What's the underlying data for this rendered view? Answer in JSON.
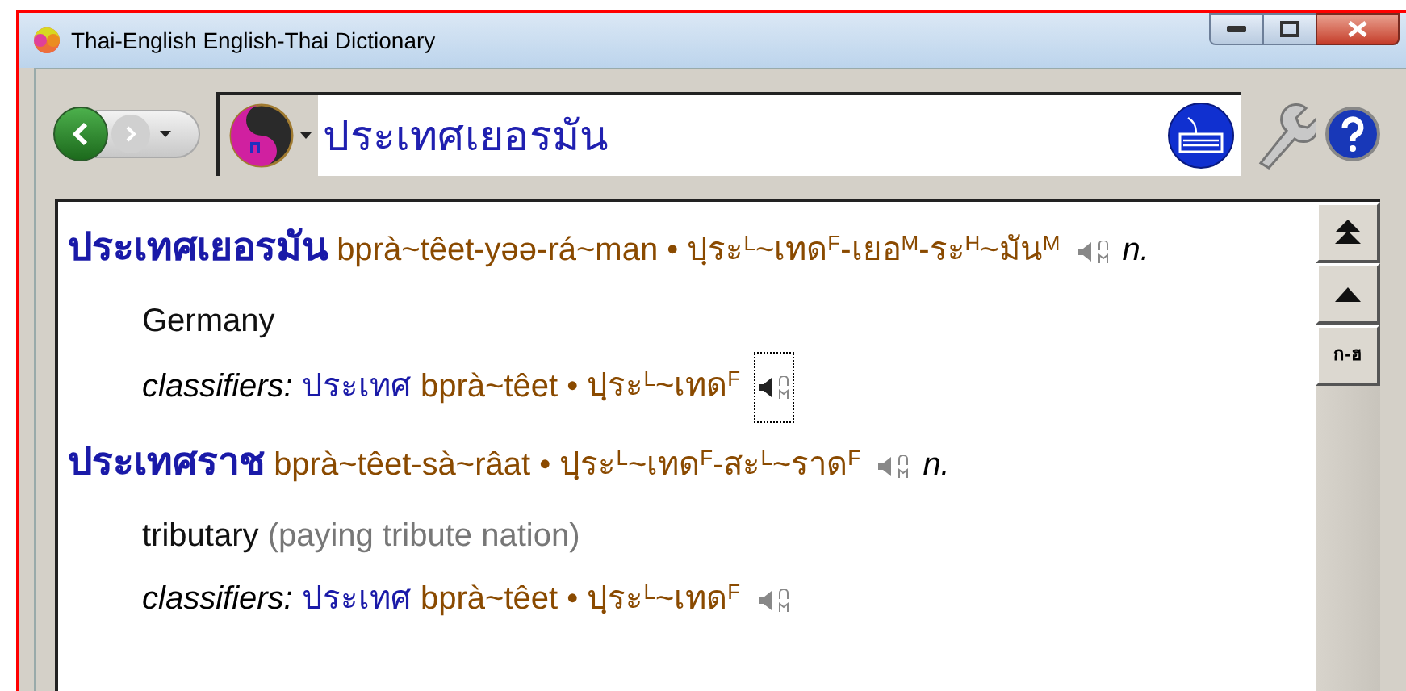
{
  "window": {
    "title": "Thai-English English-Thai Dictionary"
  },
  "search": {
    "value": "ประเทศเยอรมัน"
  },
  "scroll_buttons": [
    {
      "kind": "top"
    },
    {
      "kind": "up"
    },
    {
      "kind": "text",
      "label": "ก-ฮ"
    }
  ],
  "entries": [
    {
      "headword": "ประเทศเยอรมัน",
      "romanization": "bprà~têet-yəə-rá~man",
      "separator": "•",
      "phonetic": "ปฺระ$^{L}$~เทด$^{F}$-เยอ$^{M}$-ระ$^{H}$~มัน$^{M}$",
      "pos": "n.",
      "definition": "Germany",
      "classifier": {
        "label": "classifiers:",
        "thai": "ประเทศ",
        "romanization": "bprà~têet",
        "separator": "•",
        "phonetic": "ปฺระ$^{L}$~เทด$^{F}$",
        "focused": true
      }
    },
    {
      "headword": "ประเทศราช",
      "romanization": "bprà~têet-sà~râat",
      "separator": "•",
      "phonetic": "ปฺระ$^{L}$~เทด$^{F}$-สะ$^{L}$~ราด$^{F}$",
      "pos": "n.",
      "definition": "tributary",
      "note": "(paying tribute nation)",
      "classifier": {
        "label": "classifiers:",
        "thai": "ประเทศ",
        "romanization": "bprà~têet",
        "separator": "•",
        "phonetic": "ปฺระ$^{L}$~เทด$^{F}$",
        "focused": false
      }
    }
  ]
}
